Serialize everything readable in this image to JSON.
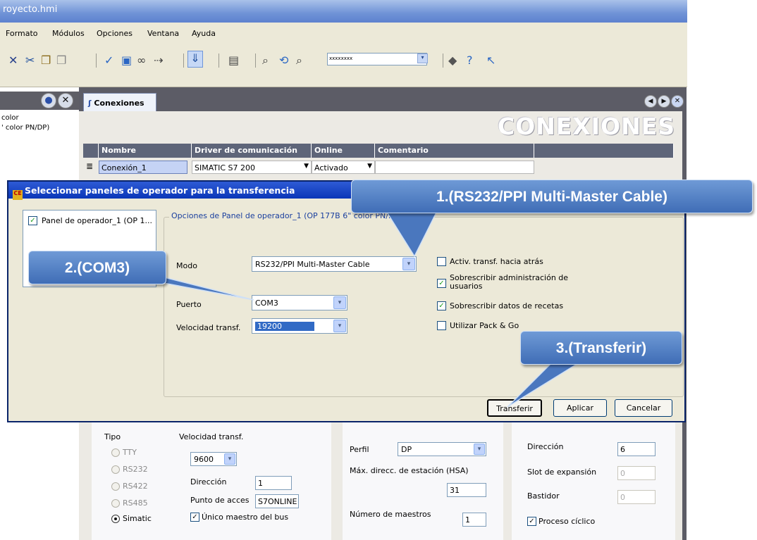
{
  "window": {
    "title": "royecto.hmi"
  },
  "menu": [
    "Formato",
    "Módulos",
    "Opciones",
    "Ventana",
    "Ayuda"
  ],
  "toolbar": {
    "combo_value": "xxxxxxxx"
  },
  "left_pane": {
    "items": [
      "color",
      "' color PN/DP)"
    ]
  },
  "editor": {
    "tab_label": "Conexiones",
    "big_title": "CONEXIONES",
    "columns": [
      "Nombre",
      "Driver de comunicación",
      "Online",
      "Comentario"
    ],
    "row": {
      "nombre": "Conexión_1",
      "driver": "SIMATIC S7 200",
      "online": "Activado",
      "comentario": ""
    }
  },
  "dialog": {
    "title": "Seleccionar paneles de operador para la transferencia",
    "tree_item": "Panel de operador_1 (OP 1...",
    "group_title": "Opciones de Panel de operador_1 (OP 177B 6\" color PN/DP)",
    "modo_label": "Modo",
    "modo_value": "RS232/PPI Multi-Master Cable",
    "puerto_label": "Puerto",
    "puerto_value": "COM3",
    "velocidad_label": "Velocidad transf.",
    "velocidad_value": "19200",
    "options": [
      {
        "label": "Activ. transf. hacia atrás",
        "checked": false
      },
      {
        "label": "Sobrescribir administración de usuarios",
        "checked": true
      },
      {
        "label": "Sobrescribir datos de recetas",
        "checked": true
      },
      {
        "label": "Utilizar Pack & Go",
        "checked": false
      }
    ],
    "buttons": {
      "transfer": "Transferir",
      "apply": "Aplicar",
      "cancel": "Cancelar"
    }
  },
  "callouts": {
    "c1": "1.(RS232/PPI Multi-Master Cable)",
    "c2": "2.(COM3)",
    "c3": "3.(Transferir)"
  },
  "params": {
    "tipo_label": "Tipo",
    "tipos": [
      "TTY",
      "RS232",
      "RS422",
      "RS485",
      "Simatic"
    ],
    "tipo_selected": "Simatic",
    "vel_label": "Velocidad transf.",
    "vel_value": "9600",
    "dir_label": "Dirección",
    "dir_value": "1",
    "punto_label": "Punto de acces",
    "punto_value": "S7ONLINE",
    "unico_label": "Único maestro del bus",
    "perfil_label": "Perfil",
    "perfil_value": "DP",
    "hsa_label": "Máx. direcc. de estación (HSA)",
    "hsa_value": "31",
    "maestros_label": "Número de maestros",
    "maestros_value": "1",
    "auto_dir_label": "Dirección",
    "auto_dir_value": "6",
    "slot_label": "Slot de expansión",
    "slot_value": "0",
    "bastidor_label": "Bastidor",
    "bastidor_value": "0",
    "ciclico_label": "Proceso cíclico"
  }
}
